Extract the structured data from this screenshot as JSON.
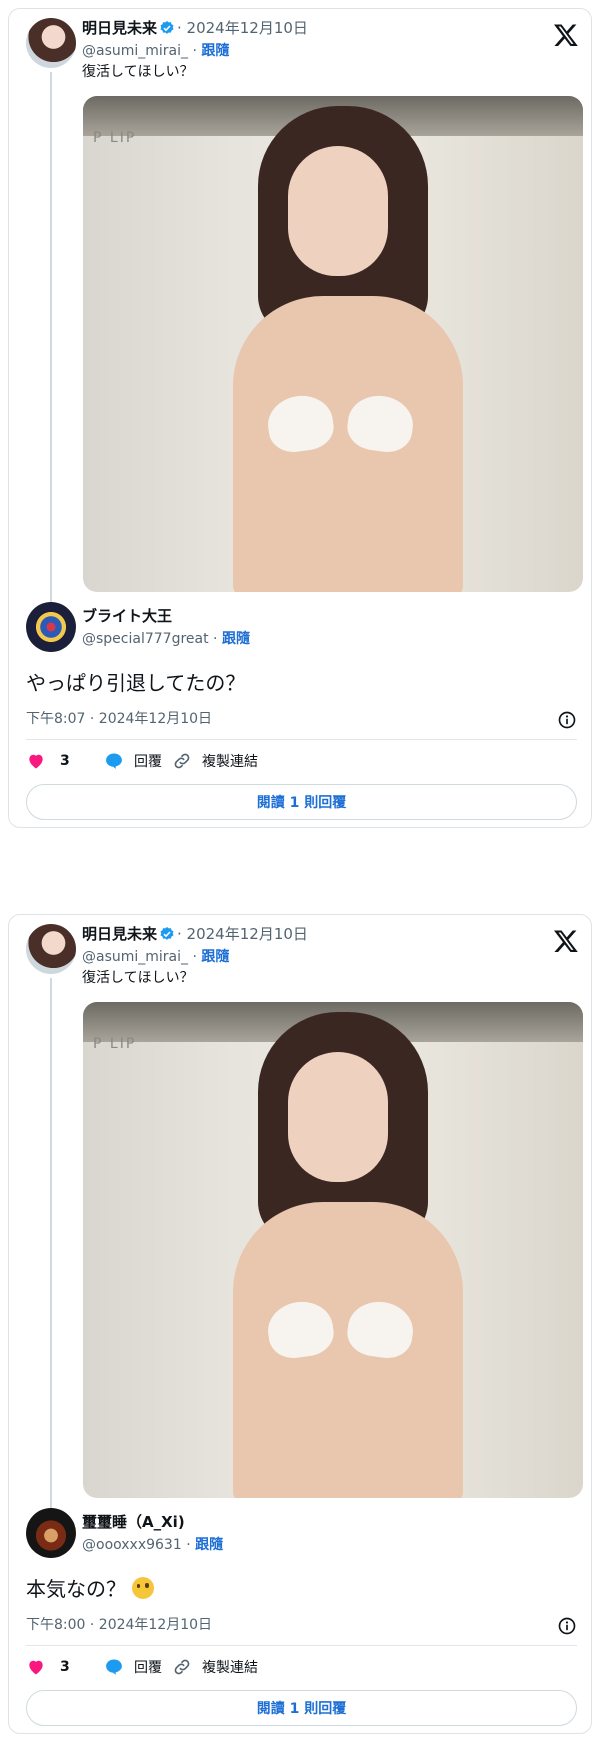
{
  "cards": [
    {
      "original": {
        "name": "明日見未来",
        "date": "· 2024年12月10日",
        "handle": "@asumi_mirai_ ·",
        "follow": "跟隨",
        "text": "復活してほしい？"
      },
      "reply": {
        "name": "ブライト大王",
        "handle": "@special777great ·",
        "follow": "跟隨",
        "text": "やっぱり引退してたの？",
        "time": "下午8:07 · 2024年12月10日",
        "likes": "3",
        "reply_label": "回覆",
        "copy_label": "複製連結",
        "read_replies": "閱讀 1 則回覆"
      }
    },
    {
      "original": {
        "name": "明日見未来",
        "date": "· 2024年12月10日",
        "handle": "@asumi_mirai_ ·",
        "follow": "跟隨",
        "text": "復活してほしい？"
      },
      "reply": {
        "name": "璽璽睡（A_Xi)",
        "handle": "@oooxxx9631 ·",
        "follow": "跟隨",
        "text": "本気なの？",
        "time": "下午8:00 · 2024年12月10日",
        "likes": "3",
        "reply_label": "回覆",
        "copy_label": "複製連結",
        "read_replies": "閱讀 1 則回覆"
      }
    }
  ],
  "photo_text": "P LIP",
  "colors": {
    "like": "#f91880",
    "reply": "#1d9bf0",
    "link": "#1d6fd6",
    "verified": "#1d9bf0"
  },
  "icons": [
    "x-logo-icon",
    "verified-icon",
    "heart-icon",
    "speech-bubble-icon",
    "link-icon",
    "info-icon",
    "thinking-face-emoji"
  ]
}
